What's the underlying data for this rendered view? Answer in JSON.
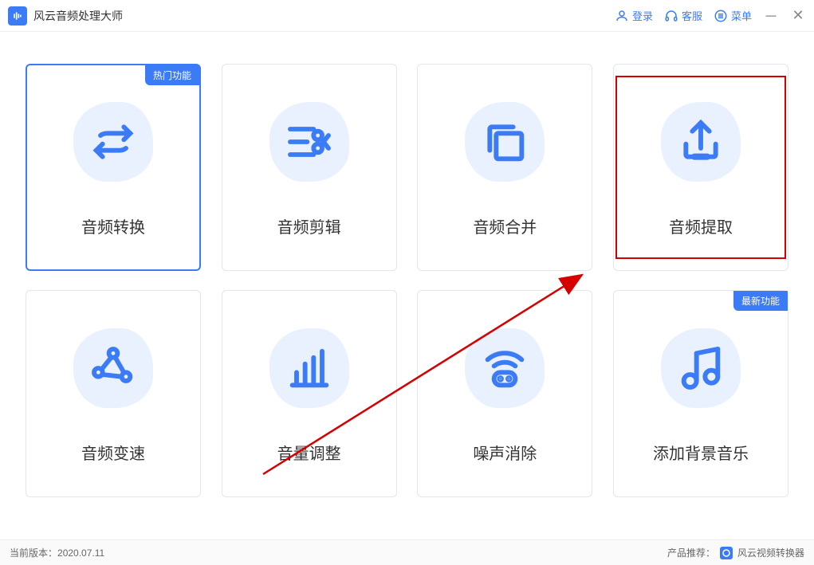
{
  "app": {
    "title": "风云音频处理大师"
  },
  "titlebar": {
    "login": "登录",
    "support": "客服",
    "menu": "菜单"
  },
  "badges": {
    "hot": "热门功能",
    "new": "最新功能"
  },
  "cards": [
    {
      "label": "音频转换"
    },
    {
      "label": "音频剪辑"
    },
    {
      "label": "音频合并"
    },
    {
      "label": "音频提取"
    },
    {
      "label": "音频变速"
    },
    {
      "label": "音量调整"
    },
    {
      "label": "噪声消除"
    },
    {
      "label": "添加背景音乐"
    }
  ],
  "footer": {
    "version_label": "当前版本：",
    "version_value": "2020.07.11",
    "promo_label": "产品推荐：",
    "promo_product": "风云视频转换器"
  }
}
